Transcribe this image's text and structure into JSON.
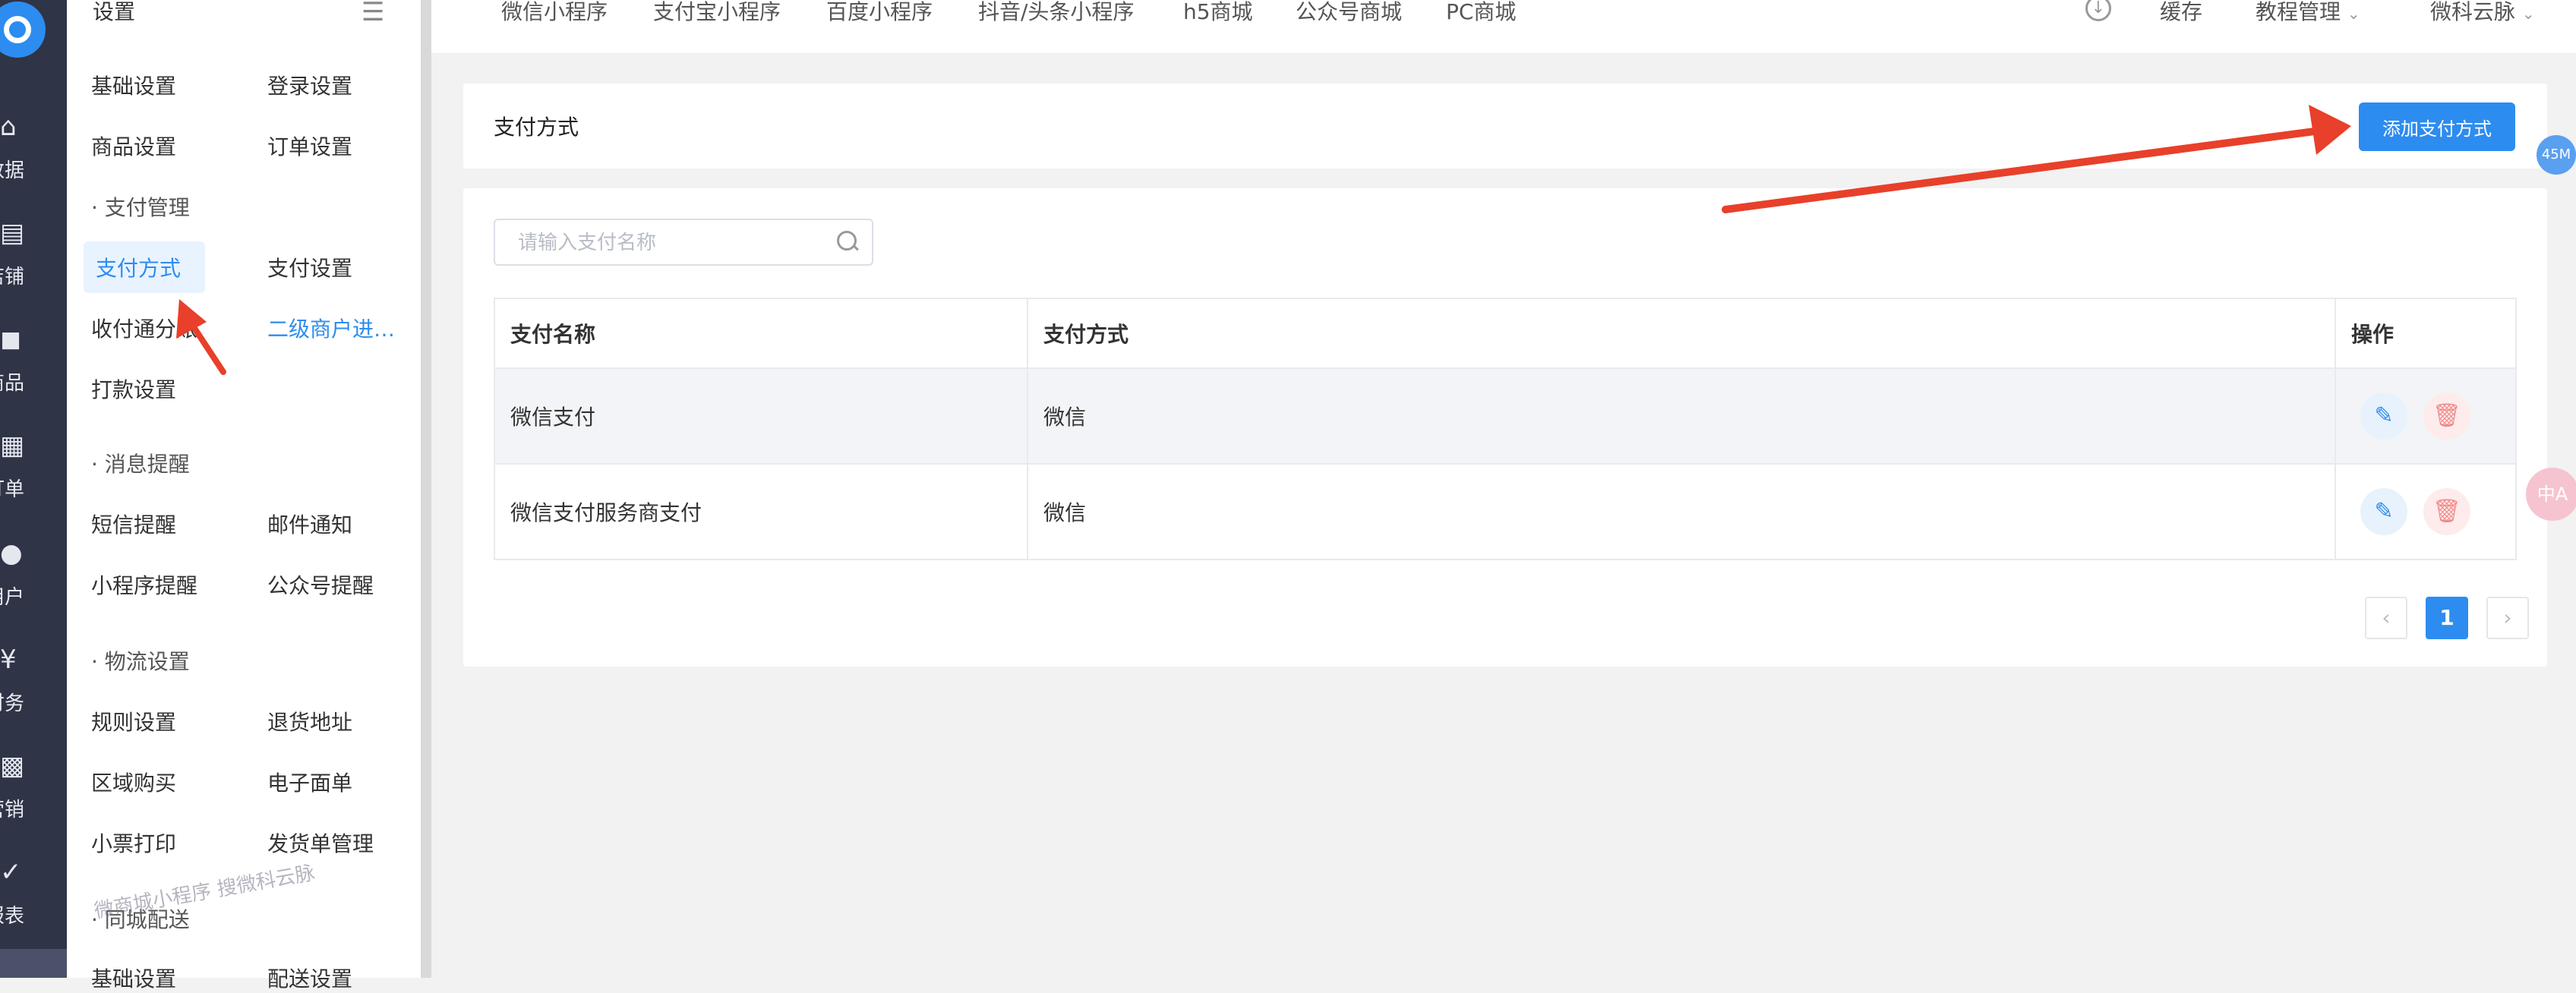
{
  "rail": {
    "items": [
      {
        "icon": "home-icon",
        "glyph": "⌂",
        "label": "数据"
      },
      {
        "icon": "store-icon",
        "glyph": "▤",
        "label": "店铺"
      },
      {
        "icon": "bag-icon",
        "glyph": "◼",
        "label": "商品"
      },
      {
        "icon": "order-icon",
        "glyph": "▦",
        "label": "订单"
      },
      {
        "icon": "user-icon",
        "glyph": "●",
        "label": "用户"
      },
      {
        "icon": "finance-icon",
        "glyph": "¥",
        "label": "财务"
      },
      {
        "icon": "marketing-icon",
        "glyph": "▩",
        "label": "营销"
      },
      {
        "icon": "report-icon",
        "glyph": "✓",
        "label": "报表"
      }
    ]
  },
  "subnav": {
    "header": "设置",
    "basic": "基础设置",
    "login": "登录设置",
    "goods": "商品设置",
    "order": "订单设置",
    "pay_group": "· 支付管理",
    "pay_method": "支付方式",
    "pay_setting": "支付设置",
    "split": "收付通分账",
    "sub_merchant": "二级商户进…",
    "payout": "打款设置",
    "msg_group": "· 消息提醒",
    "sms": "短信提醒",
    "mail": "邮件通知",
    "mini_notice": "小程序提醒",
    "mp_notice": "公众号提醒",
    "logistics_group": "· 物流设置",
    "rule": "规则设置",
    "return_addr": "退货地址",
    "region": "区域购买",
    "e_sheet": "电子面单",
    "ticket": "小票打印",
    "ship_manage": "发货单管理",
    "city_group": "· 同城配送",
    "city_basic": "基础设置",
    "city_delivery": "配送设置",
    "watermark": "微商城小程序 搜微科云脉"
  },
  "topbar": {
    "tabs": [
      "微信小程序",
      "支付宝小程序",
      "百度小程序",
      "抖音/头条小程序",
      "h5商城",
      "公众号商城",
      "PC商城"
    ],
    "cache": "缓存",
    "tutorial": "教程管理",
    "account": "微科云脉"
  },
  "page": {
    "title": "支付方式",
    "add_button": "添加支付方式",
    "search_placeholder": "请输入支付名称",
    "table": {
      "headers": [
        "支付名称",
        "支付方式",
        "操作"
      ],
      "rows": [
        {
          "name": "微信支付",
          "method": "微信"
        },
        {
          "name": "微信支付服务商支付",
          "method": "微信"
        }
      ]
    },
    "pagination": {
      "prev": "‹",
      "current": "1",
      "next": "›"
    }
  },
  "badges": {
    "memory": "45M",
    "translate": "中A"
  },
  "colors": {
    "primary": "#2d8cf0",
    "rail_bg": "#2f3447",
    "annotation_arrow": "#e8402a"
  }
}
